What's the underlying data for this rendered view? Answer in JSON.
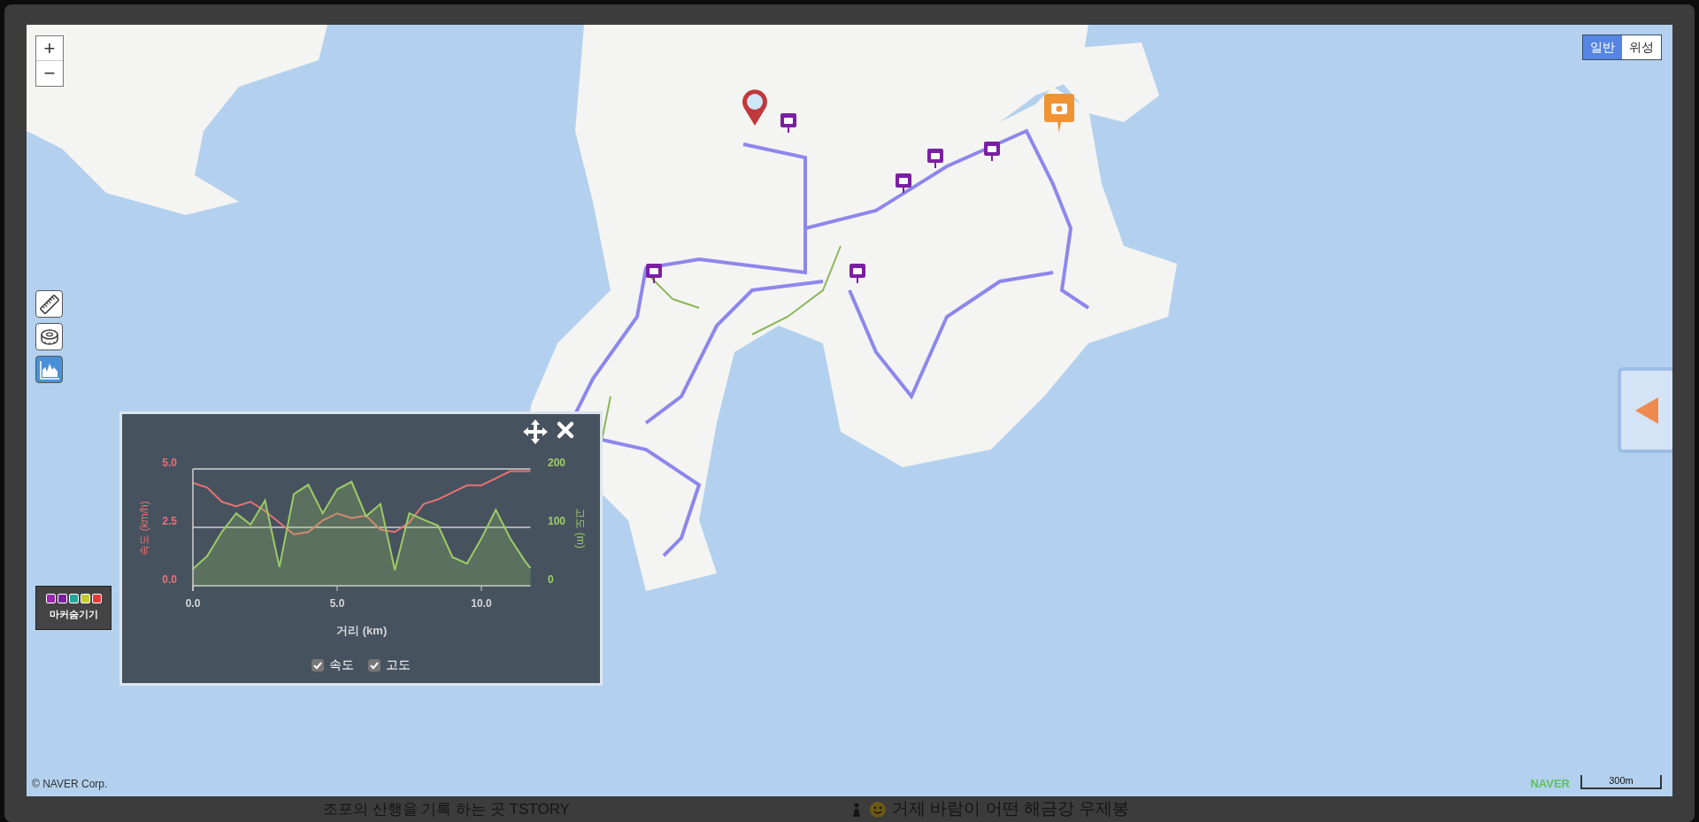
{
  "zoom_controls": [
    {
      "label": "+"
    },
    {
      "label": "−"
    }
  ],
  "map_type_toggle": [
    {
      "label": "일반",
      "selected": true
    },
    {
      "label": "위성",
      "selected": false
    }
  ],
  "tools": [
    {
      "kind": "ruler",
      "selected": false
    },
    {
      "kind": "tape",
      "selected": false
    },
    {
      "kind": "elevation",
      "selected": true
    }
  ],
  "side_panel_toggle": {
    "expanded": false
  },
  "chart_panel": {
    "chart_data": {
      "type": "line",
      "xlabel": "거리 (km)",
      "ylabel": "속도 (km/h)",
      "y2label": "고도 (m)",
      "x": [
        0,
        0.5,
        1,
        1.5,
        2,
        2.5,
        3,
        3.5,
        4,
        4.5,
        5,
        5.5,
        6,
        6.5,
        7,
        7.5,
        8,
        8.5,
        9,
        9.5,
        10,
        10.5,
        11,
        11.5,
        11.7
      ],
      "xlim": [
        0,
        11.7
      ],
      "xticks": [
        {
          "value": 0,
          "label": "0.0"
        },
        {
          "value": 5,
          "label": "5.0"
        },
        {
          "value": 10,
          "label": "10.0"
        }
      ],
      "ylim": [
        0,
        5
      ],
      "yticks": [
        {
          "value": 0,
          "label": "0.0"
        },
        {
          "value": 2.5,
          "label": "2.5"
        },
        {
          "value": 5,
          "label": "5.0"
        }
      ],
      "y2lim": [
        0,
        200
      ],
      "y2ticks": [
        0,
        100,
        200
      ],
      "series": [
        {
          "name": "속도",
          "color": "#e57373",
          "type": "line",
          "values": [
            4.4,
            4.2,
            3.6,
            3.4,
            3.6,
            3.2,
            2.7,
            2.2,
            2.3,
            2.8,
            3.1,
            2.9,
            3.0,
            2.4,
            2.3,
            2.7,
            3.5,
            3.7,
            4.0,
            4.3,
            4.3,
            4.6,
            4.9,
            4.9,
            4.9
          ]
        },
        {
          "name": "고도",
          "color": "#9ccc65",
          "axis": "y2",
          "type": "area",
          "values": [
            29,
            51,
            92,
            124,
            105,
            146,
            32,
            157,
            173,
            124,
            165,
            178,
            119,
            140,
            27,
            124,
            113,
            103,
            49,
            38,
            81,
            130,
            81,
            43,
            30
          ]
        }
      ]
    },
    "legend": [
      {
        "checked": true
      },
      {
        "checked": true
      }
    ]
  },
  "marker_toggle": {
    "label": "마커숨기기",
    "markers": [
      {
        "color": "#9c27b0"
      },
      {
        "color": "#7b1fa2"
      },
      {
        "color": "#26a69a"
      },
      {
        "color": "#c0ca33"
      },
      {
        "color": "#e53935"
      }
    ]
  },
  "copyright": "© NAVER Corp.",
  "logo": "NAVER",
  "scale": "300m",
  "background_page": {
    "blog_title": "조포의 산행을 기록 하는 곳 TSTORY",
    "post_title": "거제 바람이 어떤 해금강 우제봉"
  }
}
